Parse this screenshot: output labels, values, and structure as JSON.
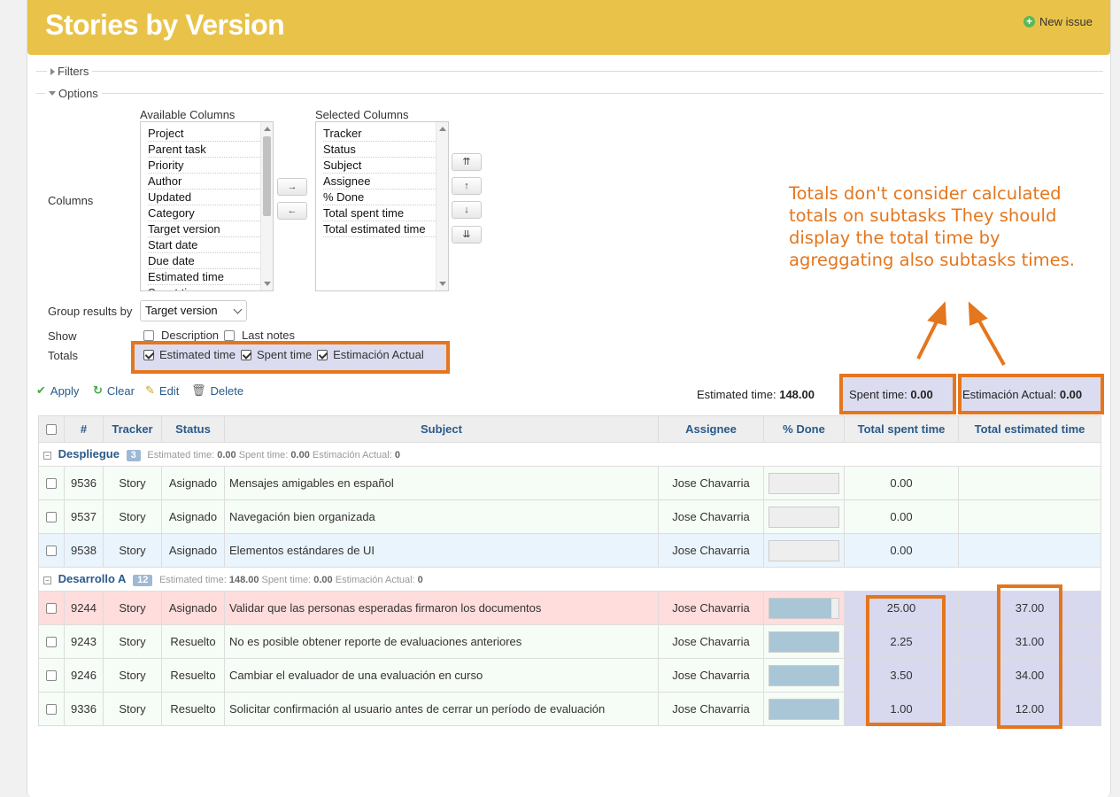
{
  "header": {
    "title": "Stories by Version",
    "new_issue": "New issue"
  },
  "fieldsets": {
    "filters": "Filters",
    "options": "Options"
  },
  "columns": {
    "label": "Columns",
    "available_label": "Available Columns",
    "selected_label": "Selected Columns",
    "available": [
      "Project",
      "Parent task",
      "Priority",
      "Author",
      "Updated",
      "Category",
      "Target version",
      "Start date",
      "Due date",
      "Estimated time",
      "Spent time"
    ],
    "selected": [
      "Tracker",
      "Status",
      "Subject",
      "Assignee",
      "% Done",
      "Total spent time",
      "Total estimated time"
    ],
    "move_right": "→",
    "move_left": "←",
    "move_top": "⇈",
    "move_up": "↑",
    "move_down": "↓",
    "move_bottom": "⇊"
  },
  "group_by": {
    "label": "Group results by",
    "value": "Target version"
  },
  "show": {
    "label": "Show",
    "description": "Description",
    "last_notes": "Last notes"
  },
  "totals": {
    "label": "Totals",
    "estimated": "Estimated time",
    "spent": "Spent time",
    "actual": "Estimación Actual"
  },
  "actions": {
    "apply": "Apply",
    "clear": "Clear",
    "edit": "Edit",
    "delete": "Delete"
  },
  "summary": {
    "estimated_label": "Estimated time:",
    "estimated_value": "148.00",
    "spent_label": "Spent time:",
    "spent_value": "0.00",
    "actual_label": "Estimación Actual:",
    "actual_value": "0.00"
  },
  "annotation": "Totals don't consider calculated totals on subtasks They should display the total time by agreggating also subtasks times.",
  "table": {
    "headers": [
      "#",
      "Tracker",
      "Status",
      "Subject",
      "Assignee",
      "% Done",
      "Total spent time",
      "Total estimated time"
    ],
    "groups": [
      {
        "name": "Despliegue",
        "count": "3",
        "est_label": "Estimated time:",
        "est": "0.00",
        "spent_label": "Spent time:",
        "spent": "0.00",
        "act_label": "Estimación Actual:",
        "act": "0"
      },
      {
        "name": "Desarrollo A",
        "count": "12",
        "est_label": "Estimated time:",
        "est": "148.00",
        "spent_label": "Spent time:",
        "spent": "0.00",
        "act_label": "Estimación Actual:",
        "act": "0"
      }
    ],
    "rows": [
      {
        "id": "9536",
        "tracker": "Story",
        "status": "Asignado",
        "subject": "Mensajes amigables en español",
        "assignee": "Jose Chavarria",
        "done": 0,
        "spent": "0.00",
        "estimated": ""
      },
      {
        "id": "9537",
        "tracker": "Story",
        "status": "Asignado",
        "subject": "Navegación bien organizada",
        "assignee": "Jose Chavarria",
        "done": 0,
        "spent": "0.00",
        "estimated": ""
      },
      {
        "id": "9538",
        "tracker": "Story",
        "status": "Asignado",
        "subject": "Elementos estándares de UI",
        "assignee": "Jose Chavarria",
        "done": 0,
        "spent": "0.00",
        "estimated": ""
      },
      {
        "id": "9244",
        "tracker": "Story",
        "status": "Asignado",
        "subject": "Validar que las personas esperadas firmaron los documentos",
        "assignee": "Jose Chavarria",
        "done": 90,
        "spent": "25.00",
        "estimated": "37.00"
      },
      {
        "id": "9243",
        "tracker": "Story",
        "status": "Resuelto",
        "subject": "No es posible obtener reporte de evaluaciones anteriores",
        "assignee": "Jose Chavarria",
        "done": 100,
        "spent": "2.25",
        "estimated": "31.00"
      },
      {
        "id": "9246",
        "tracker": "Story",
        "status": "Resuelto",
        "subject": "Cambiar el evaluador de una evaluación en curso",
        "assignee": "Jose Chavarria",
        "done": 100,
        "spent": "3.50",
        "estimated": "34.00"
      },
      {
        "id": "9336",
        "tracker": "Story",
        "status": "Resuelto",
        "subject": "Solicitar confirmación al usuario antes de cerrar un período de evaluación",
        "assignee": "Jose Chavarria",
        "done": 100,
        "spent": "1.00",
        "estimated": "12.00"
      }
    ]
  }
}
